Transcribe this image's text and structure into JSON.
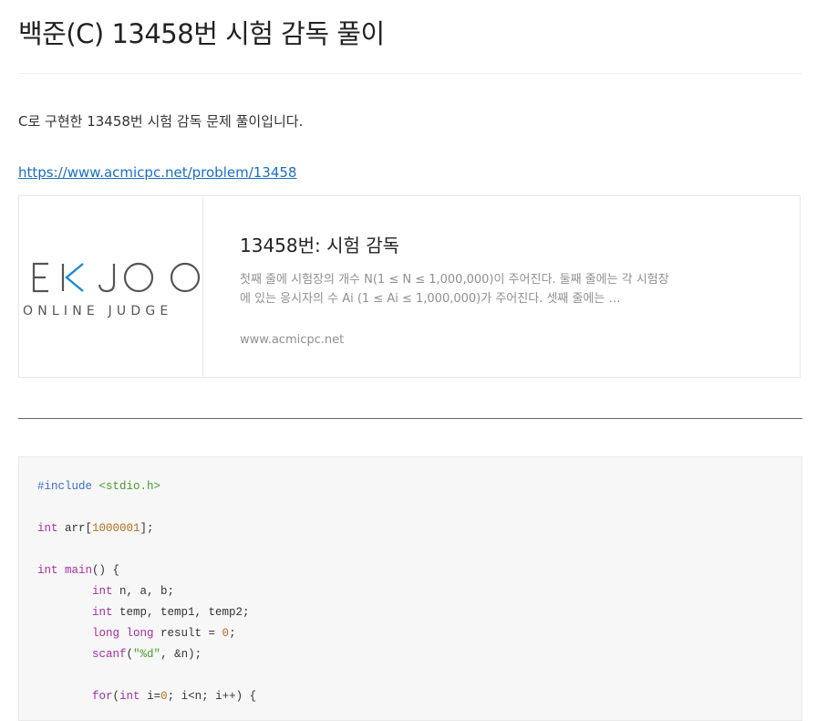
{
  "post": {
    "title": "백준(C) 13458번 시험 감독 풀이",
    "intro": "C로 구현한 13458번 시험 감독 문제 풀이입니다.",
    "link_text": "https://www.acmicpc.net/problem/13458"
  },
  "og_card": {
    "logo_alt": "BAEKJOON ONLINE JUDGE logo",
    "logo_text_partial": "EKJOO",
    "logo_subtext_partial": "ONLINE JUDGE",
    "title": "13458번: 시험 감독",
    "description": "첫째 줄에 시험장의 개수 N(1 ≤ N ≤ 1,000,000)이 주어진다. 둘째 줄에는 각 시험장에 있는 응시자의 수 Ai (1 ≤ Ai ≤ 1,000,000)가 주어진다. 셋째 줄에는 …",
    "site": "www.acmicpc.net",
    "colors": {
      "logo_gray": "#555555",
      "logo_blue": "#1a8ad4"
    }
  },
  "code": {
    "language": "c",
    "lines": [
      [
        {
          "t": "meta",
          "v": "#include "
        },
        {
          "t": "str",
          "v": "<stdio.h>"
        }
      ],
      [],
      [
        {
          "t": "kw",
          "v": "int"
        },
        {
          "t": "plain",
          "v": " arr["
        },
        {
          "t": "num",
          "v": "1000001"
        },
        {
          "t": "plain",
          "v": "];"
        }
      ],
      [],
      [
        {
          "t": "kw",
          "v": "int"
        },
        {
          "t": "plain",
          "v": " "
        },
        {
          "t": "fn",
          "v": "main"
        },
        {
          "t": "plain",
          "v": "() {"
        }
      ],
      [
        {
          "t": "plain",
          "v": "        "
        },
        {
          "t": "kw",
          "v": "int"
        },
        {
          "t": "plain",
          "v": " n, a, b;"
        }
      ],
      [
        {
          "t": "plain",
          "v": "        "
        },
        {
          "t": "kw",
          "v": "int"
        },
        {
          "t": "plain",
          "v": " temp, temp1, temp2;"
        }
      ],
      [
        {
          "t": "plain",
          "v": "        "
        },
        {
          "t": "kw",
          "v": "long long"
        },
        {
          "t": "plain",
          "v": " result = "
        },
        {
          "t": "num",
          "v": "0"
        },
        {
          "t": "plain",
          "v": ";"
        }
      ],
      [
        {
          "t": "plain",
          "v": "        "
        },
        {
          "t": "fn",
          "v": "scanf"
        },
        {
          "t": "plain",
          "v": "("
        },
        {
          "t": "str",
          "v": "\"%d\""
        },
        {
          "t": "plain",
          "v": ", &n);"
        }
      ],
      [],
      [
        {
          "t": "plain",
          "v": "        "
        },
        {
          "t": "kw",
          "v": "for"
        },
        {
          "t": "plain",
          "v": "("
        },
        {
          "t": "kw",
          "v": "int"
        },
        {
          "t": "plain",
          "v": " i="
        },
        {
          "t": "num",
          "v": "0"
        },
        {
          "t": "plain",
          "v": "; i<n; i++) {"
        }
      ]
    ]
  },
  "theme": {
    "link": "#1a6fc4",
    "keyword": "#a42ea2",
    "meta": "#3b6fc9",
    "string": "#4b9b2b",
    "number": "#b0701c"
  }
}
